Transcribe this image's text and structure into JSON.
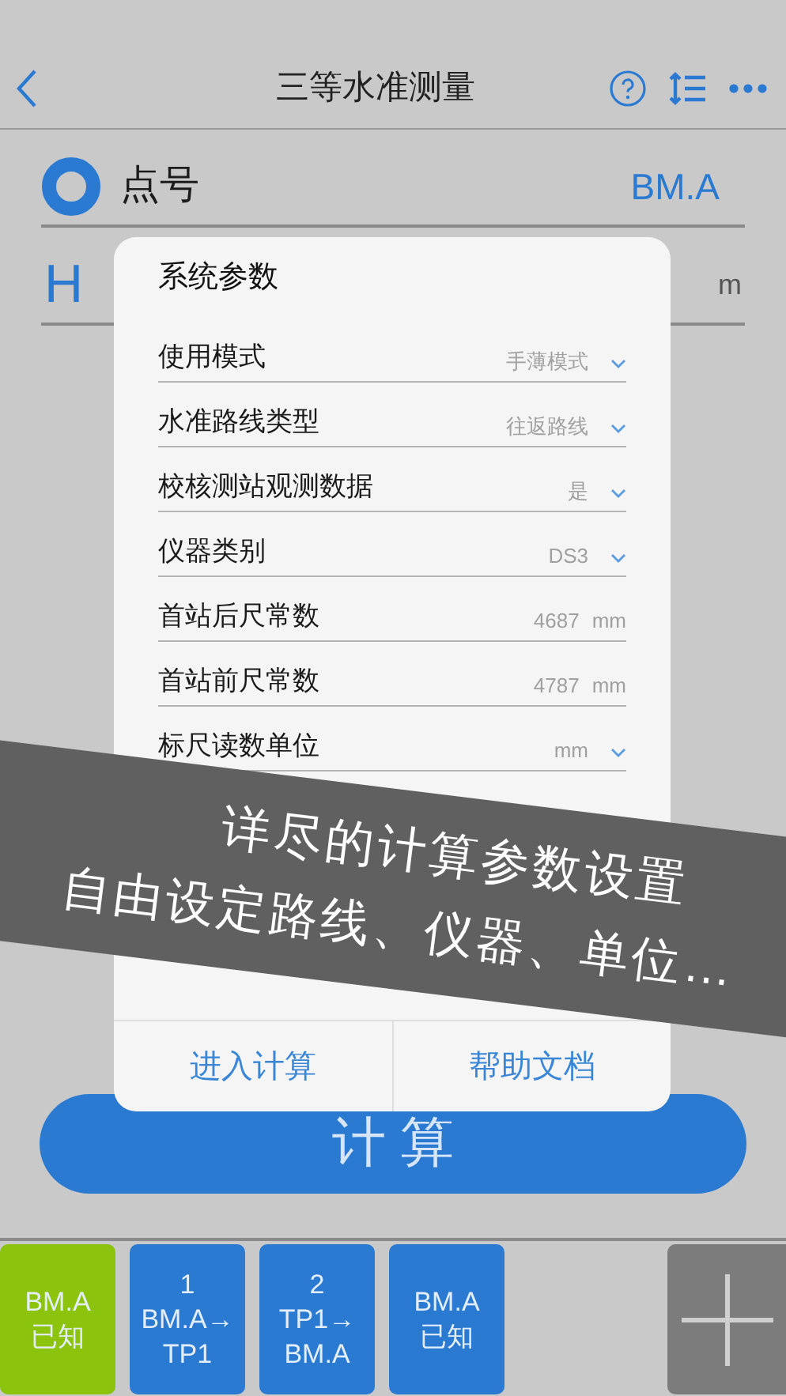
{
  "nav": {
    "title": "三等水准测量"
  },
  "point": {
    "label": "点号",
    "value": "BM.A"
  },
  "height": {
    "label": "H",
    "unit": "m"
  },
  "dialog": {
    "title": "系统参数",
    "rows": [
      {
        "kind": "select",
        "label": "使用模式",
        "value": "手薄模式"
      },
      {
        "kind": "select",
        "label": "水准路线类型",
        "value": "往返路线"
      },
      {
        "kind": "select",
        "label": "校核测站观测数据",
        "value": "是"
      },
      {
        "kind": "select",
        "label": "仪器类别",
        "value": "DS3"
      },
      {
        "kind": "number",
        "label": "首站后尺常数",
        "value": "4687",
        "unit": "mm"
      },
      {
        "kind": "number",
        "label": "首站前尺常数",
        "value": "4787",
        "unit": "mm"
      },
      {
        "kind": "select",
        "label": "标尺读数单位",
        "value": "mm"
      }
    ],
    "buttons": [
      "进入计算",
      "帮助文档"
    ]
  },
  "calc_button": "计 算",
  "stations": [
    {
      "lines": [
        "BM.A",
        "已知"
      ],
      "color": "#8cc30c"
    },
    {
      "lines": [
        "1",
        "BM.A→",
        "TP1"
      ],
      "color": "#2a7ad2"
    },
    {
      "lines": [
        "2",
        "TP1→",
        "BM.A"
      ],
      "color": "#2a7ad2"
    },
    {
      "lines": [
        "BM.A",
        "已知"
      ],
      "color": "#2a7ad2"
    }
  ],
  "banner": {
    "lines": [
      "详尽的计算参数设置",
      "自由设定路线、仪器、单位…"
    ]
  }
}
